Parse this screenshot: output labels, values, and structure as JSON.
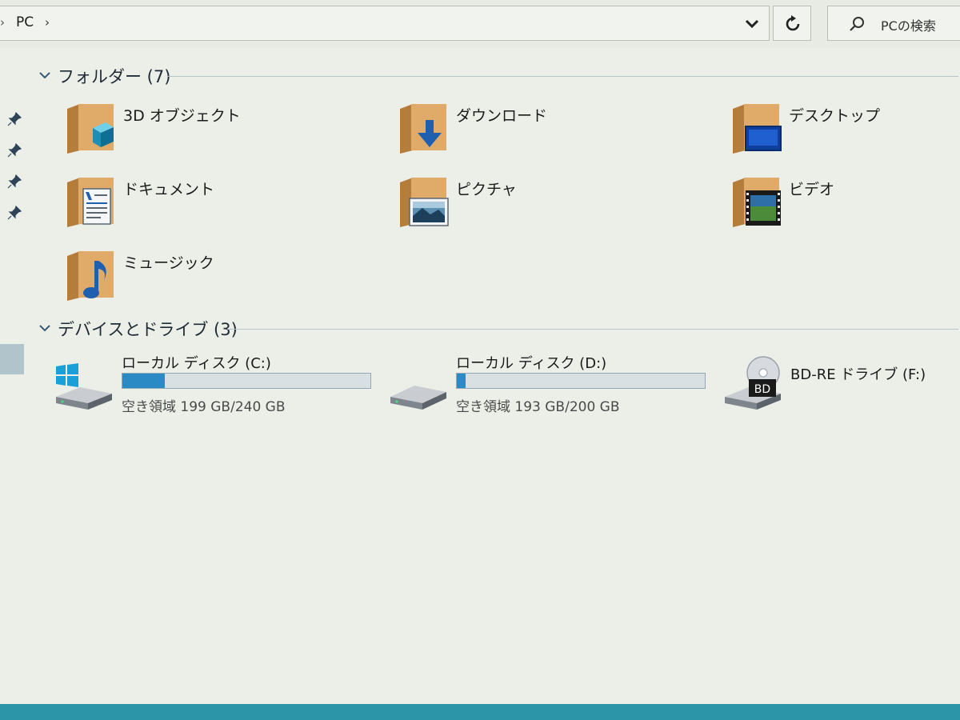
{
  "address_bar": {
    "crumb": "PC",
    "dropdown_icon": "chevron-down-icon"
  },
  "refresh_icon": "refresh-icon",
  "search": {
    "placeholder": "PCの検索",
    "icon": "search-icon"
  },
  "folders_section": {
    "title": "フォルダー (7)",
    "items": [
      {
        "label": "3D オブジェクト",
        "icon": "3d-objects-folder-icon"
      },
      {
        "label": "ダウンロード",
        "icon": "downloads-folder-icon"
      },
      {
        "label": "デスクトップ",
        "icon": "desktop-folder-icon"
      },
      {
        "label": "ドキュメント",
        "icon": "documents-folder-icon"
      },
      {
        "label": "ピクチャ",
        "icon": "pictures-folder-icon"
      },
      {
        "label": "ビデオ",
        "icon": "videos-folder-icon"
      },
      {
        "label": "ミュージック",
        "icon": "music-folder-icon"
      }
    ]
  },
  "drives_section": {
    "title": "デバイスとドライブ (3)",
    "drives": [
      {
        "name": "ローカル ディスク (C:)",
        "free_text": "空き領域 199 GB/240 GB",
        "used_fraction": 0.17,
        "icon": "windows-drive-icon"
      },
      {
        "name": "ローカル ディスク (D:)",
        "free_text": "空き領域 193 GB/200 GB",
        "used_fraction": 0.035,
        "icon": "hard-drive-icon"
      },
      {
        "name": "BD-RE ドライブ (F:)",
        "icon": "bd-drive-icon",
        "badge": "BD"
      }
    ]
  },
  "colors": {
    "accent": "#2a8ac4",
    "taskbar": "#2d95a8",
    "folder": "#d9a463"
  }
}
